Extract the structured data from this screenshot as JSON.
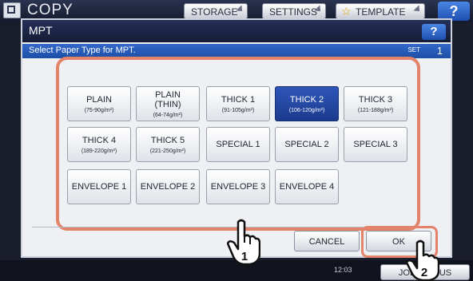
{
  "topbar": {
    "title": "COPY",
    "storage": "STORAGE",
    "settings": "SETTINGS",
    "template": "TEMPLATE",
    "help": "?"
  },
  "dialog": {
    "title": "MPT",
    "help": "?",
    "instruction": "Select Paper Type for MPT.",
    "set_label": "SET",
    "set_value": "1"
  },
  "paper_types": [
    {
      "name": "PLAIN",
      "sub": "(75-90g/m²)",
      "selected": false
    },
    {
      "name": "PLAIN\n(THIN)",
      "sub": "(64-74g/m²)",
      "selected": false
    },
    {
      "name": "THICK 1",
      "sub": "(91-105g/m²)",
      "selected": false
    },
    {
      "name": "THICK 2",
      "sub": "(106-120g/m²)",
      "selected": true
    },
    {
      "name": "THICK 3",
      "sub": "(121-188g/m²)",
      "selected": false
    },
    {
      "name": "THICK 4",
      "sub": "(189-220g/m²)",
      "selected": false
    },
    {
      "name": "THICK 5",
      "sub": "(221-250g/m²)",
      "selected": false
    },
    {
      "name": "SPECIAL 1",
      "sub": "",
      "selected": false
    },
    {
      "name": "SPECIAL 2",
      "sub": "",
      "selected": false
    },
    {
      "name": "SPECIAL 3",
      "sub": "",
      "selected": false
    },
    {
      "name": "ENVELOPE 1",
      "sub": "",
      "selected": false
    },
    {
      "name": "ENVELOPE 2",
      "sub": "",
      "selected": false
    },
    {
      "name": "ENVELOPE 3",
      "sub": "",
      "selected": false
    },
    {
      "name": "ENVELOPE 4",
      "sub": "",
      "selected": false
    }
  ],
  "actions": {
    "cancel": "CANCEL",
    "ok": "OK"
  },
  "callouts": {
    "step1": "1",
    "step2": "2"
  },
  "status": {
    "time": "12:03",
    "job_status": "JOB STATUS"
  },
  "colors": {
    "highlight": "#e2836a",
    "selected": "#1c3a8e"
  }
}
